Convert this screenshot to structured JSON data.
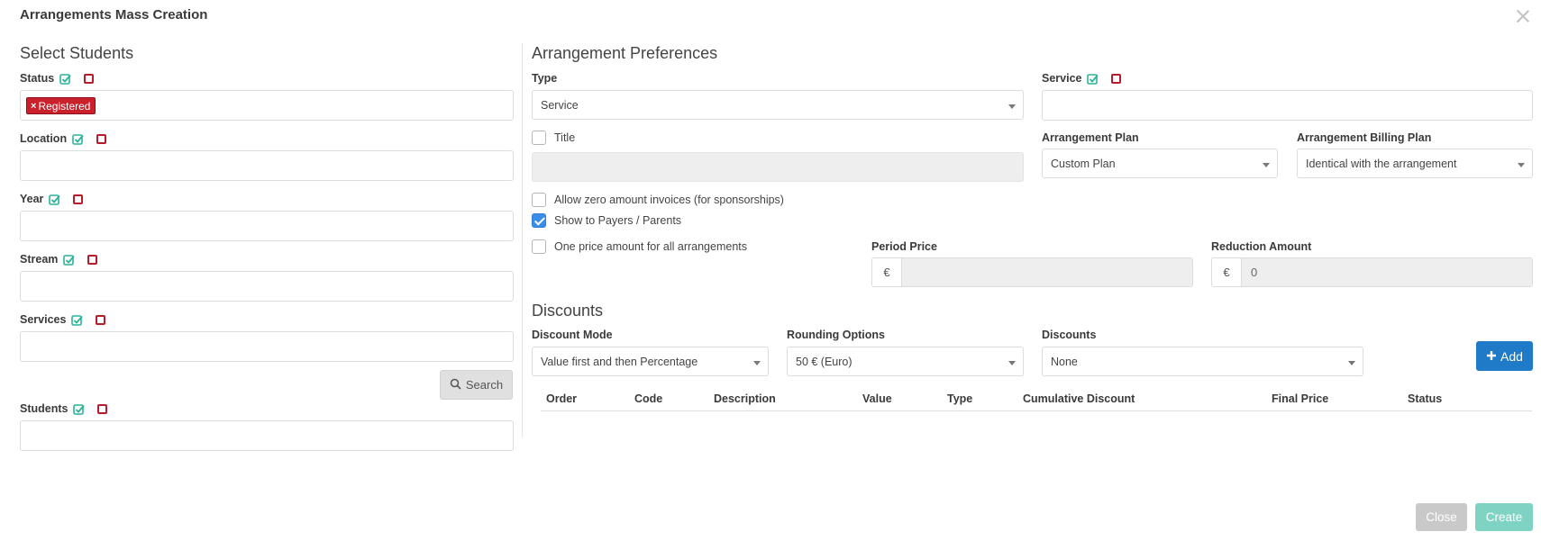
{
  "modal": {
    "title": "Arrangements Mass Creation"
  },
  "left": {
    "heading": "Select Students",
    "status": {
      "label": "Status",
      "tag": "Registered"
    },
    "location": {
      "label": "Location"
    },
    "year": {
      "label": "Year"
    },
    "stream": {
      "label": "Stream"
    },
    "services": {
      "label": "Services"
    },
    "search_label": "Search",
    "students": {
      "label": "Students"
    }
  },
  "prefs": {
    "heading": "Arrangement Preferences",
    "type_label": "Type",
    "type_value": "Service",
    "title_checkbox": "Title",
    "allow_zero": "Allow zero amount invoices (for sponsorships)",
    "show_payers": "Show to Payers / Parents",
    "one_price": "One price amount for all arrangements",
    "service_label": "Service",
    "plan_label": "Arrangement Plan",
    "plan_value": "Custom Plan",
    "billing_label": "Arrangement Billing Plan",
    "billing_value": "Identical with the arrangement",
    "period_price_label": "Period Price",
    "reduction_label": "Reduction Amount",
    "currency_symbol": "€",
    "reduction_value": "0"
  },
  "discounts": {
    "heading": "Discounts",
    "mode_label": "Discount Mode",
    "mode_value": "Value first and then Percentage",
    "rounding_label": "Rounding Options",
    "rounding_value": "50 € (Euro)",
    "discounts_label": "Discounts",
    "discounts_value": "None",
    "add_label": "Add",
    "columns": [
      "Order",
      "Code",
      "Description",
      "Value",
      "Type",
      "Cumulative Discount",
      "Final Price",
      "Status"
    ]
  },
  "footer": {
    "close_label": "Close",
    "create_label": "Create"
  },
  "colors": {
    "primary": "#1f7bc7",
    "danger": "#c9202b",
    "success": "#2bb39a",
    "create": "#7fd3c2"
  }
}
